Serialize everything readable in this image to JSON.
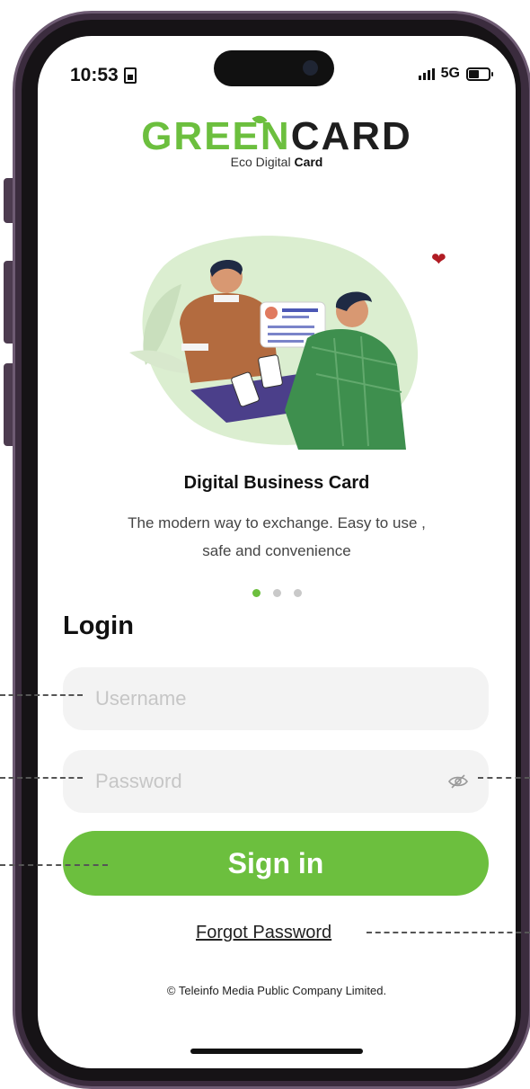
{
  "status_bar": {
    "time": "10:53",
    "network": "5G"
  },
  "logo": {
    "brand_green": "GREEN",
    "brand_dark": "CARD",
    "tagline_prefix": "Eco Digital",
    "tagline_bold": "Card"
  },
  "intro": {
    "headline": "Digital Business Card",
    "description": "The modern way to exchange. Easy to use , safe and convenience",
    "page_indicator": {
      "total": 3,
      "active_index": 0
    }
  },
  "login": {
    "title": "Login",
    "username": {
      "placeholder": "Username",
      "value": ""
    },
    "password": {
      "placeholder": "Password",
      "value": ""
    },
    "sign_in_label": "Sign in",
    "forgot_password_label": "Forgot Password"
  },
  "footer": {
    "copyright": "© Teleinfo Media Public Company Limited."
  },
  "colors": {
    "accent": "#6cbf3e",
    "heart": "#b11c24",
    "frame": "#3b2c3e"
  },
  "icons": [
    "sim-icon",
    "signal-icon",
    "battery-icon",
    "heart-icon",
    "eye-icon"
  ]
}
